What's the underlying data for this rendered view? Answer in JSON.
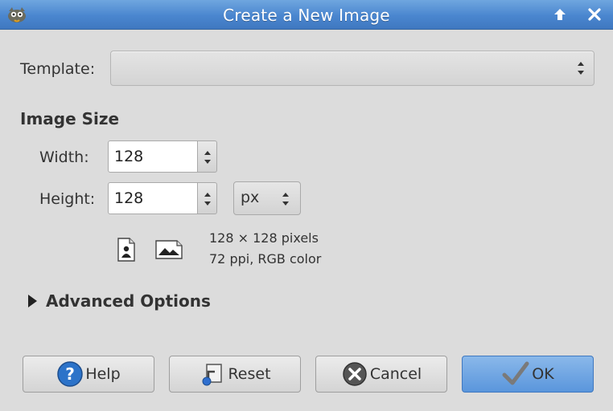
{
  "window": {
    "title": "Create a New Image",
    "titlebar_color": "#4a86cf",
    "icons": {
      "app": "gimp-icon",
      "up": "arrow-up-icon",
      "close": "close-icon"
    }
  },
  "template": {
    "label": "Template:",
    "value": ""
  },
  "image_size": {
    "title": "Image Size",
    "width_label": "Width:",
    "width_value": "128",
    "height_label": "Height:",
    "height_value": "128",
    "unit": "px",
    "orientation_icons": [
      "portrait-icon",
      "landscape-icon"
    ],
    "info_line1": "128 × 128 pixels",
    "info_line2": "72 ppi, RGB color"
  },
  "advanced": {
    "label": "Advanced Options",
    "expanded": false
  },
  "buttons": {
    "help": "Help",
    "reset": "Reset",
    "cancel": "Cancel",
    "ok": "OK",
    "ok_color": "#6aa3e2"
  }
}
